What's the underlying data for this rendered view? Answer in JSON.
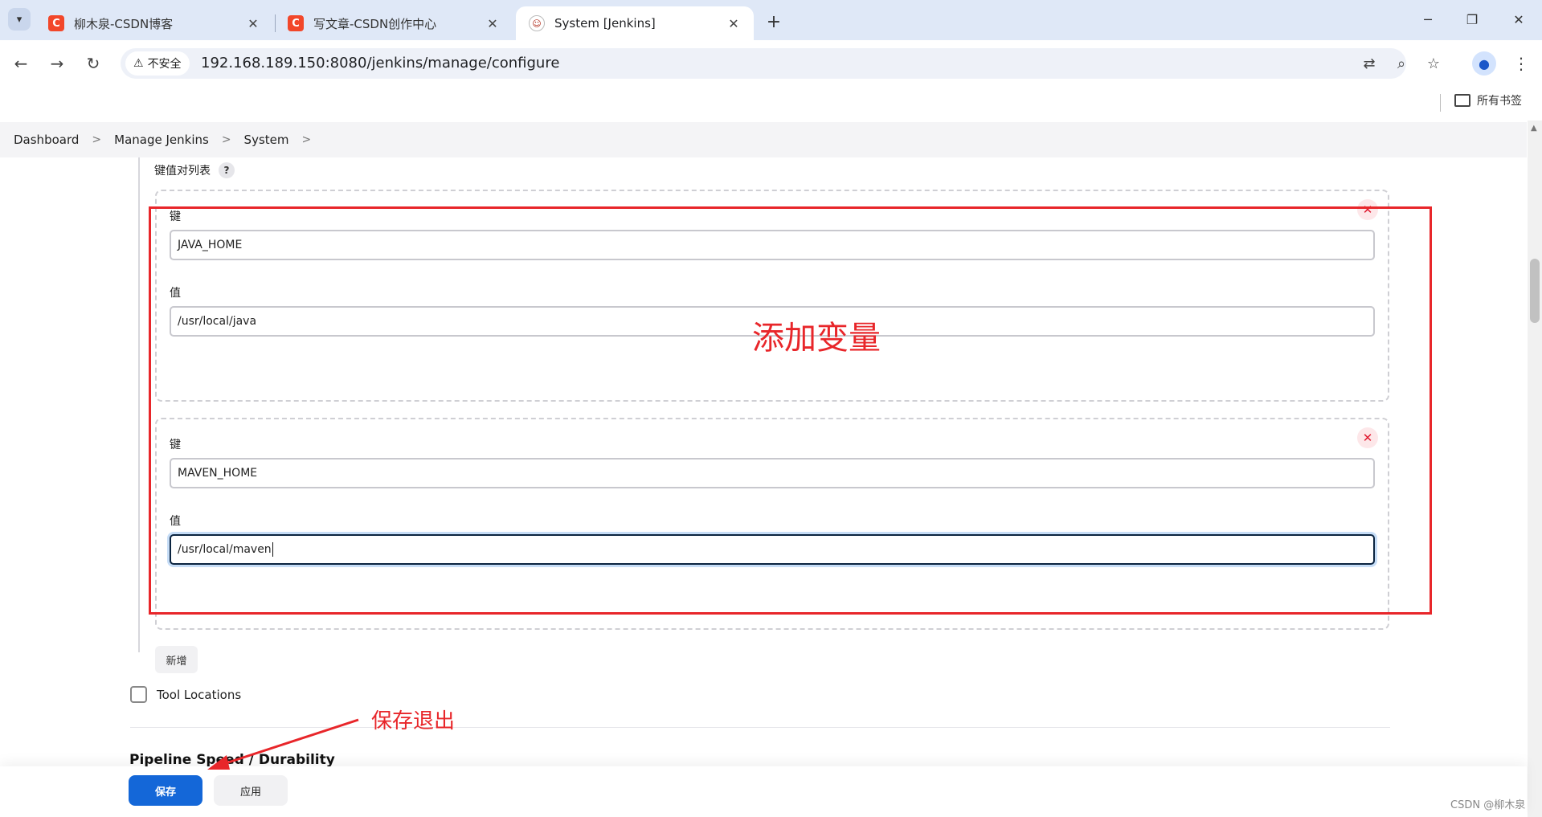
{
  "browser": {
    "tabs": [
      {
        "title": "柳木泉-CSDN博客",
        "favicon": "C"
      },
      {
        "title": "写文章-CSDN创作中心",
        "favicon": "C"
      },
      {
        "title": "System [Jenkins]",
        "favicon": "jenkins-icon"
      }
    ],
    "security_label": "不安全",
    "url": "192.168.189.150:8080/jenkins/manage/configure",
    "bookmarks_label": "所有书签"
  },
  "breadcrumb": [
    "Dashboard",
    "Manage Jenkins",
    "System"
  ],
  "env_vars": {
    "section_label": "键值对列表",
    "help_label": "?",
    "items": [
      {
        "key_label": "键",
        "key_value": "JAVA_HOME",
        "value_label": "值",
        "value_value": "/usr/local/java"
      },
      {
        "key_label": "键",
        "key_value": "MAVEN_HOME",
        "value_label": "值",
        "value_value": "/usr/local/maven"
      }
    ],
    "add_label": "新增"
  },
  "tool_locations_label": "Tool Locations",
  "pipeline_heading": "Pipeline Speed / Durability",
  "actions": {
    "save_label": "保存",
    "apply_label": "应用"
  },
  "annotations": {
    "box_text": "添加变量",
    "arrow_text": "保存退出",
    "color": "#e8262a"
  },
  "watermark": "CSDN @柳木泉",
  "colors": {
    "primary": "#1467d8",
    "danger": "#e0192f",
    "tabstrip": "#dfe8f7"
  }
}
